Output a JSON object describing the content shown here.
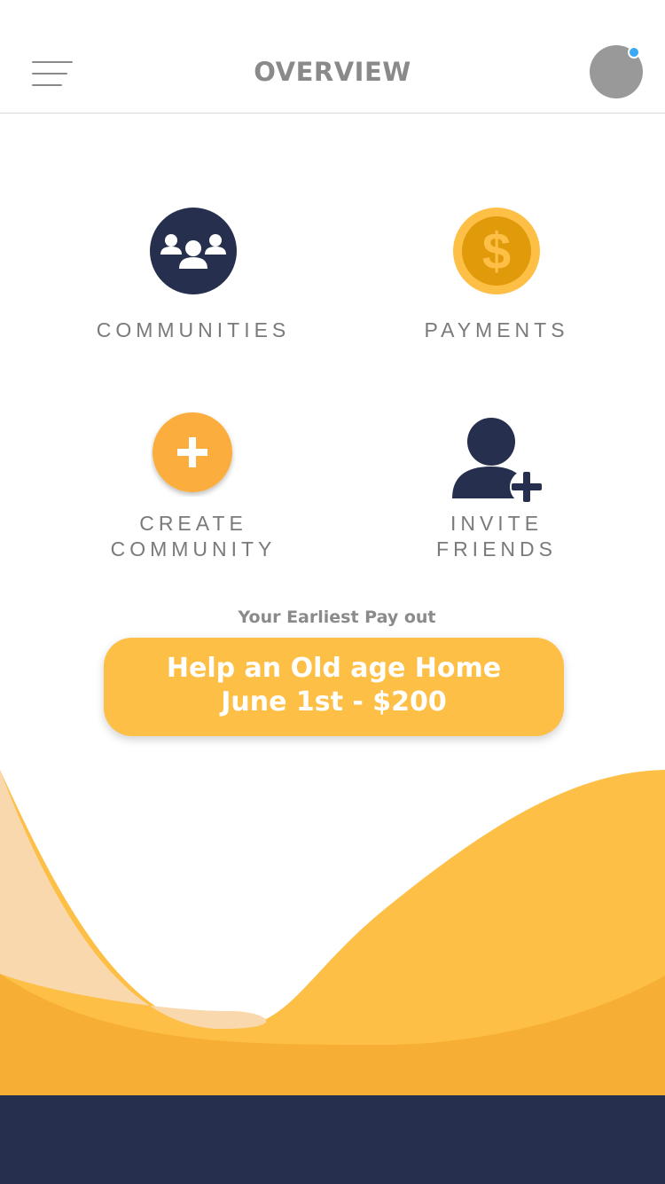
{
  "header": {
    "title": "OVERVIEW",
    "menu_icon": "hamburger-menu-icon",
    "has_notification": true
  },
  "tiles": [
    {
      "id": "communities",
      "label_lines": [
        "COMMUNITIES"
      ],
      "icon": "people-group-icon"
    },
    {
      "id": "payments",
      "label_lines": [
        "PAYMENTS"
      ],
      "icon": "dollar-coin-icon"
    },
    {
      "id": "create-community",
      "label_lines": [
        "CREATE",
        "COMMUNITY"
      ],
      "icon": "plus-circle-icon"
    },
    {
      "id": "invite-friends",
      "label_lines": [
        "INVITE",
        "FRIENDS"
      ],
      "icon": "add-user-icon"
    }
  ],
  "payout": {
    "caption": "Your Earliest Pay out",
    "line1": "Help an Old age Home",
    "line2": "June 1st - $200"
  },
  "colors": {
    "navy": "#262f4e",
    "accent_yellow": "#fdbf45",
    "orange": "#f7ae35",
    "light_peach": "#f8d8ac",
    "notification_blue": "#3aa8f5"
  }
}
